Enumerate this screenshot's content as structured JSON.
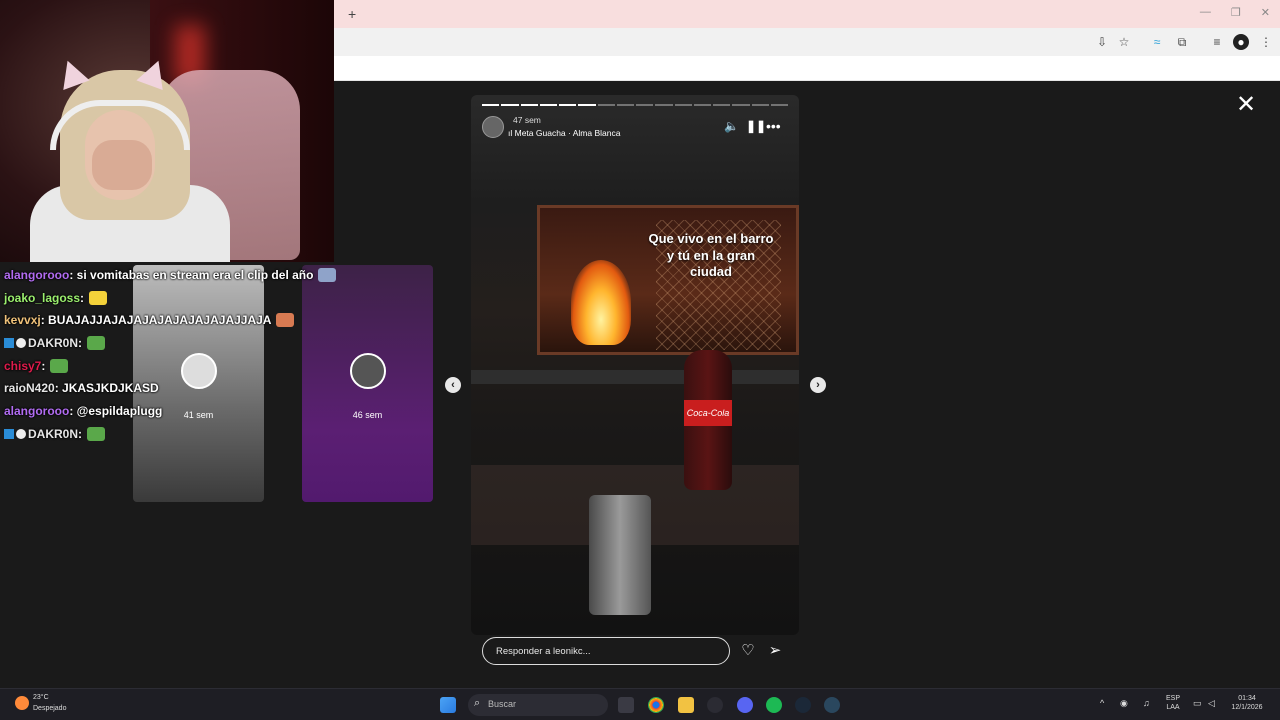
{
  "browser": {
    "new_tab_glyph": "+",
    "window_controls": [
      "—",
      "❐",
      "✕"
    ],
    "toolbar_icons": [
      "install-icon",
      "star-icon",
      "translate-icon",
      "extensions-icon",
      "reading-list-icon",
      "profile-icon",
      "menu-icon"
    ]
  },
  "chat": {
    "messages": [
      {
        "user": "alangorooo",
        "user_color": "#b26cf2",
        "text": ": si vomitabas en stream era el clip del año",
        "emote_color": "#8fa3c9"
      },
      {
        "user": "joako_lagoss",
        "user_color": "#9bef6e",
        "text": ":",
        "emote_color": "#f4d23a"
      },
      {
        "user": "kevvxj",
        "user_color": "#f0c27a",
        "text": ": BUAJAJJAJAJAJAJAJAJAJAJAJJAJA",
        "emote_color": "#d77a52"
      },
      {
        "user": "DAKR0N",
        "user_color": "#e6e6e6",
        "text": ":",
        "emote_color": "#5aa84a",
        "badges": true
      },
      {
        "user": "chisy7",
        "user_color": "#e01b4c",
        "text": ":",
        "emote_color": "#5aa84a"
      },
      {
        "user": "raioN420",
        "user_color": "#e6e6e6",
        "text": ": JKASJKDJKASD"
      },
      {
        "user": "alangorooo",
        "user_color": "#b26cf2",
        "text": ": @espildaplugg"
      },
      {
        "user": "DAKR0N",
        "user_color": "#e6e6e6",
        "text": ":",
        "emote_color": "#5aa84a",
        "badges": true
      }
    ]
  },
  "previews": [
    {
      "ago": "41 sem"
    },
    {
      "ago": "46 sem"
    }
  ],
  "story": {
    "segments_total": 16,
    "segments_done": 6,
    "time_ago": "47 sem",
    "music": "Meta Guacha · Alma Blanca",
    "overlay_text": "Que vivo en el barro\ny tú en la gran\nciudad",
    "bottle_label": "Coca-Cola",
    "reply_placeholder": "Responder a leonikc...",
    "icons": [
      "volume-icon",
      "pause-icon",
      "more-icon",
      "heart-icon",
      "send-icon"
    ]
  },
  "close_glyph": "✕",
  "nav": {
    "prev": "‹",
    "next": "›"
  },
  "taskbar": {
    "weather_temp": "23°C",
    "weather_desc": "Despejado",
    "search_placeholder": "Buscar",
    "lang_top": "ESP",
    "lang_bottom": "LAA",
    "time": "01:34",
    "date": "12/1/2026"
  }
}
